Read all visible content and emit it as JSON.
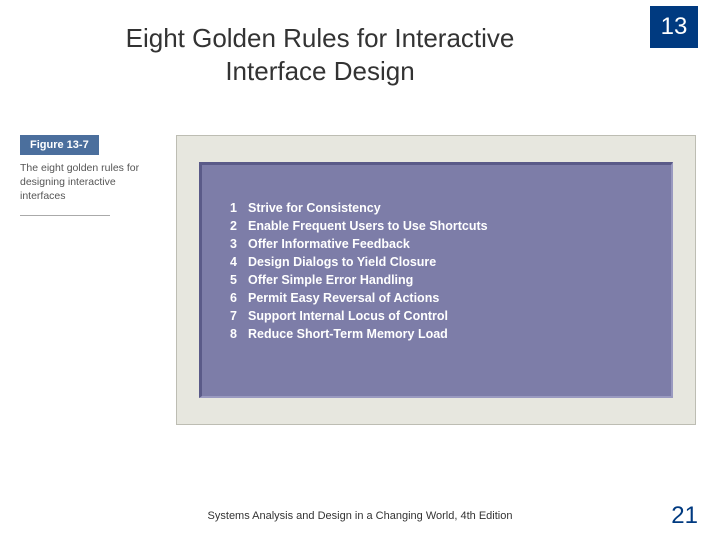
{
  "chapter": "13",
  "title": "Eight Golden Rules for Interactive Interface Design",
  "figure": {
    "label": "Figure 13-7",
    "caption": "The eight golden rules for designing interactive interfaces",
    "rules": [
      {
        "n": "1",
        "text": "Strive for Consistency"
      },
      {
        "n": "2",
        "text": "Enable Frequent Users to Use Shortcuts"
      },
      {
        "n": "3",
        "text": "Offer Informative Feedback"
      },
      {
        "n": "4",
        "text": "Design Dialogs to Yield Closure"
      },
      {
        "n": "5",
        "text": "Offer Simple Error Handling"
      },
      {
        "n": "6",
        "text": "Permit Easy Reversal of Actions"
      },
      {
        "n": "7",
        "text": "Support Internal Locus of Control"
      },
      {
        "n": "8",
        "text": "Reduce Short-Term Memory Load"
      }
    ]
  },
  "footer": "Systems Analysis and Design in a Changing World, 4th Edition",
  "page": "21"
}
